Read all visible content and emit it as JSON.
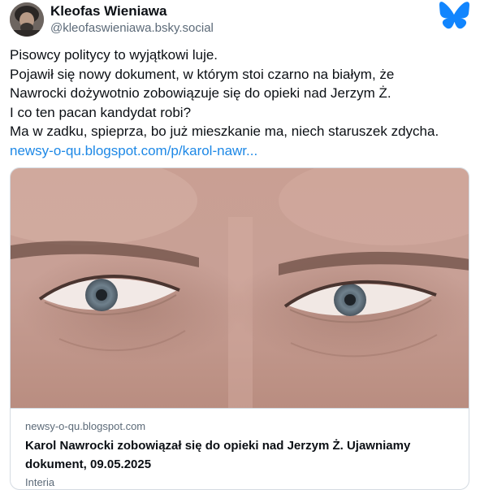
{
  "author": {
    "display_name": "Kleofas Wieniawa",
    "handle": "@kleofaswieniawa.bsky.social",
    "avatar_icon": "user-avatar"
  },
  "app": {
    "logo_icon": "bluesky-butterfly-icon",
    "accent_color": "#1185fe"
  },
  "post": {
    "lines": [
      "Pisowcy politycy to wyjątkowi luje.",
      "Pojawił się nowy dokument, w którym stoi czarno na białym, że",
      "Nawrocki dożywotnio zobowiązuje się do opieki nad Jerzym Ż.",
      "I co ten pacan kandydat robi?",
      "Ma w zadku, spieprza, bo już mieszkanie ma, niech staruszek zdycha."
    ],
    "link_text": "newsy-o-qu.blogspot.com/p/karol-nawr..."
  },
  "link_card": {
    "domain": "newsy-o-qu.blogspot.com",
    "title_line1": "Karol Nawrocki zobowiązał się do opieki nad Jerzym Ż. Ujawniamy",
    "title_line2": "dokument, 09.05.2025",
    "source": "Interia"
  }
}
